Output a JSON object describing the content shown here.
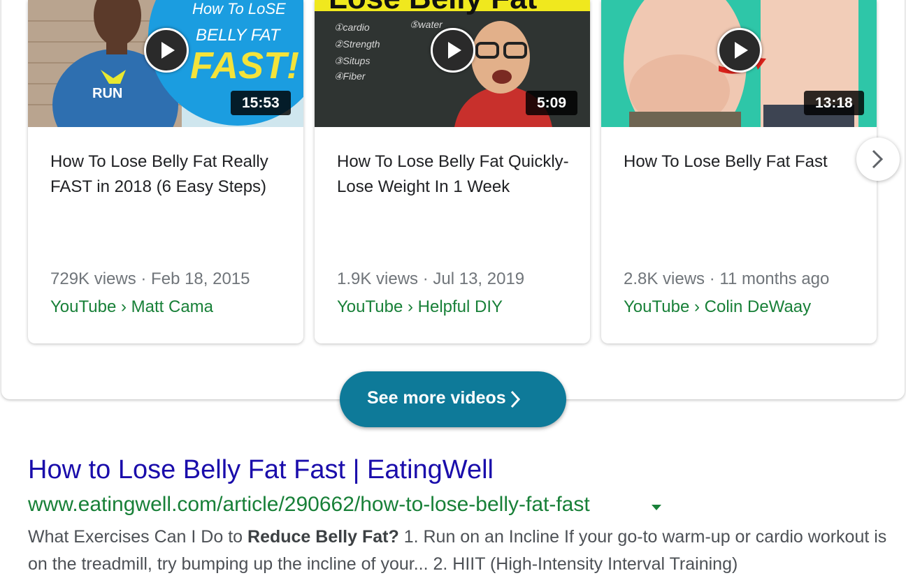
{
  "videos": [
    {
      "duration": "15:53",
      "title": "How To Lose Belly Fat Really FAST in 2018 (6 Easy Steps)",
      "meta": "729K views · Feb 18, 2015",
      "source": "YouTube › Matt Cama",
      "thumb_text": [
        "How To LoSE",
        "BELLY FAT",
        "FAST!"
      ],
      "shirt_text": "RUN"
    },
    {
      "duration": "5:09",
      "title": "How To Lose Belly Fat Quickly-Lose Weight In 1 Week",
      "meta": "1.9K views · Jul 13, 2019",
      "source": "YouTube › Helpful DIY",
      "thumb_text": [
        "Lose Belly Fat"
      ],
      "board_text": [
        "①cardio",
        "②Strength",
        "③Situps",
        "④Fiber",
        "⑤water"
      ]
    },
    {
      "duration": "13:18",
      "title": "How To Lose Belly Fat Fast",
      "meta": "2.8K views · 11 months ago",
      "source": "YouTube › Colin DeWaay"
    }
  ],
  "icons": {
    "play": "play-icon",
    "next": "chevron-right-icon",
    "caret": "caret-down-icon"
  },
  "see_more": {
    "label": "See more videos"
  },
  "result": {
    "title": "How to Lose Belly Fat Fast | EatingWell",
    "url": "www.eatingwell.com/article/290662/how-to-lose-belly-fat-fast",
    "snippet_pre": "What Exercises Can I Do to ",
    "snippet_bold": "Reduce Belly Fat?",
    "snippet_post": " 1. Run on an Incline If your go-to warm-up or cardio workout is on the treadmill, try bumping up the incline of your... 2. HIIT (High-Intensity Interval Training)"
  },
  "colors": {
    "link": "#1a0dab",
    "url_green": "#188038",
    "button_teal": "#0e7a99",
    "meta_gray": "#70757a"
  }
}
